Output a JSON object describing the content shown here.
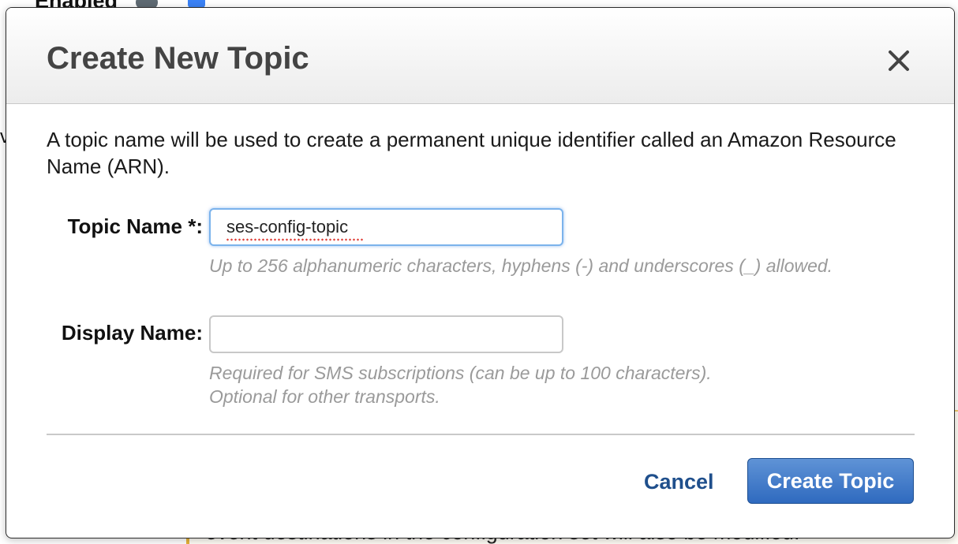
{
  "background": {
    "enabled_label": "Enabled",
    "bottom_text": "event destinations in the configuration set will also be modified."
  },
  "dialog": {
    "title": "Create New Topic",
    "close_icon": "close-icon",
    "intro": "A topic name will be used to create a permanent unique identifier called an Amazon Resource Name (ARN).",
    "topic_name": {
      "label": "Topic Name *:",
      "value": "ses-config-topic",
      "hint": "Up to 256 alphanumeric characters, hyphens (-) and underscores (_) allowed."
    },
    "display_name": {
      "label": "Display Name:",
      "value": "",
      "hint_line1": "Required for SMS subscriptions (can be up to 100 characters).",
      "hint_line2": "Optional for other transports."
    },
    "cancel_label": "Cancel",
    "create_label": "Create Topic"
  },
  "colors": {
    "primary_button": "#2f6abf",
    "link": "#1f4f8c",
    "hint_text": "#9a9a9a",
    "focus_ring": "#7bb3ec"
  }
}
